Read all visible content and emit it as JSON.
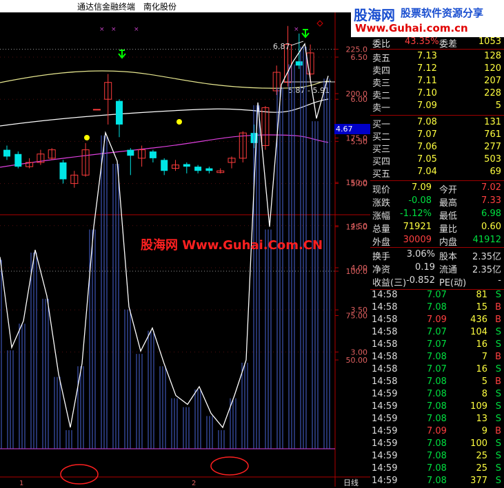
{
  "title": {
    "app": "通达信金融终端",
    "stock": "南化股份"
  },
  "logo": {
    "brand": "股海网",
    "slogan": "股票软件资源分享",
    "url": "Www.Guhai.com.cn"
  },
  "watermark": "股海网 Www.Guhai.Com.CN",
  "price_axis": [
    "6.50",
    "6.00",
    "5.50",
    "5.00",
    "4.50",
    "4.00",
    "3.50",
    "3.00"
  ],
  "current_price_tag": "4.67",
  "annotations": {
    "high_label": "6.87",
    "range_label": "5.87 - 5.91"
  },
  "indicator_axis": [
    "250.0",
    "225.0",
    "200.0",
    "175.0",
    "150.0",
    "125.0",
    "100.0",
    "75.00",
    "50.00"
  ],
  "bottom": {
    "period_label": "日线",
    "mark1": "1",
    "mark2": "2"
  },
  "quote": {
    "top": {
      "wei_bi_label": "委比",
      "wei_bi": "43.35%",
      "wei_cha_label": "委差",
      "wei_cha": "1053"
    },
    "sell": [
      {
        "label": "卖五",
        "price": "7.13",
        "vol": "128"
      },
      {
        "label": "卖四",
        "price": "7.12",
        "vol": "120"
      },
      {
        "label": "卖三",
        "price": "7.11",
        "vol": "207"
      },
      {
        "label": "卖二",
        "price": "7.10",
        "vol": "228"
      },
      {
        "label": "卖一",
        "price": "7.09",
        "vol": "5"
      }
    ],
    "buy": [
      {
        "label": "买一",
        "price": "7.08",
        "vol": "131"
      },
      {
        "label": "买二",
        "price": "7.07",
        "vol": "761"
      },
      {
        "label": "买三",
        "price": "7.06",
        "vol": "277"
      },
      {
        "label": "买四",
        "price": "7.05",
        "vol": "503"
      },
      {
        "label": "买五",
        "price": "7.04",
        "vol": "69"
      }
    ],
    "stats": [
      {
        "l1": "现价",
        "v1": "7.09",
        "l2": "今开",
        "v2": "7.02"
      },
      {
        "l1": "涨跌",
        "v1": "-0.08",
        "l2": "最高",
        "v2": "7.33"
      },
      {
        "l1": "涨幅",
        "v1": "-1.12%",
        "l2": "最低",
        "v2": "6.98"
      },
      {
        "l1": "总量",
        "v1": "71921",
        "l2": "量比",
        "v2": "0.60"
      },
      {
        "l1": "外盘",
        "v1": "30009",
        "l2": "内盘",
        "v2": "41912"
      }
    ],
    "stats2": [
      {
        "l1": "换手",
        "v1": "3.06%",
        "l2": "股本",
        "v2": "2.35亿"
      },
      {
        "l1": "净资",
        "v1": "0.19",
        "l2": "流通",
        "v2": "2.35亿"
      },
      {
        "l1": "收益(三)",
        "v1": "-0.852",
        "l2": "PE(动)",
        "v2": "-"
      }
    ]
  },
  "ticks": [
    {
      "time": "14:58",
      "price": "7.07",
      "vol": "81",
      "side": "S"
    },
    {
      "time": "14:58",
      "price": "7.08",
      "vol": "15",
      "side": "B"
    },
    {
      "time": "14:58",
      "price": "7.09",
      "vol": "436",
      "side": "B"
    },
    {
      "time": "14:58",
      "price": "7.07",
      "vol": "104",
      "side": "S"
    },
    {
      "time": "14:58",
      "price": "7.07",
      "vol": "16",
      "side": "S"
    },
    {
      "time": "14:58",
      "price": "7.08",
      "vol": "7",
      "side": "B"
    },
    {
      "time": "14:58",
      "price": "7.07",
      "vol": "16",
      "side": "S"
    },
    {
      "time": "14:58",
      "price": "7.08",
      "vol": "5",
      "side": "B"
    },
    {
      "time": "14:59",
      "price": "7.08",
      "vol": "8",
      "side": "S"
    },
    {
      "time": "14:59",
      "price": "7.08",
      "vol": "109",
      "side": "S"
    },
    {
      "time": "14:59",
      "price": "7.08",
      "vol": "13",
      "side": "S"
    },
    {
      "time": "14:59",
      "price": "7.09",
      "vol": "9",
      "side": "B"
    },
    {
      "time": "14:59",
      "price": "7.08",
      "vol": "100",
      "side": "S"
    },
    {
      "time": "14:59",
      "price": "7.08",
      "vol": "25",
      "side": "S"
    },
    {
      "time": "14:59",
      "price": "7.08",
      "vol": "25",
      "side": "S"
    },
    {
      "time": "14:59",
      "price": "7.08",
      "vol": "377",
      "side": "S"
    }
  ],
  "colors": {
    "up": "#ff3c3c",
    "down": "#00e5e5",
    "yellow": "#ffff00",
    "ma_white": "#ffffff",
    "ma_yellow": "#e8e890",
    "ma_purple": "#e040e0"
  },
  "candles": [
    {
      "o": 5.4,
      "c": 5.32,
      "h": 5.45,
      "l": 5.28
    },
    {
      "o": 5.35,
      "c": 5.2,
      "h": 5.38,
      "l": 5.18
    },
    {
      "o": 5.2,
      "c": 5.25,
      "h": 5.3,
      "l": 5.18
    },
    {
      "o": 5.25,
      "c": 5.35,
      "h": 5.4,
      "l": 5.22
    },
    {
      "o": 5.3,
      "c": 5.4,
      "h": 5.42,
      "l": 5.28
    },
    {
      "o": 5.25,
      "c": 5.05,
      "h": 5.28,
      "l": 5.0
    },
    {
      "o": 5.0,
      "c": 5.1,
      "h": 5.15,
      "l": 4.95
    },
    {
      "o": 5.1,
      "c": 5.4,
      "h": 5.48,
      "l": 5.08
    },
    {
      "o": 5.88,
      "c": 5.88,
      "h": 5.88,
      "l": 5.88
    },
    {
      "o": 6.0,
      "c": 6.2,
      "h": 6.3,
      "l": 5.7
    },
    {
      "o": 5.98,
      "c": 5.7,
      "h": 6.0,
      "l": 5.55
    },
    {
      "o": 5.4,
      "c": 5.33,
      "h": 5.42,
      "l": 5.1
    },
    {
      "o": 5.3,
      "c": 5.4,
      "h": 5.45,
      "l": 5.2
    },
    {
      "o": 5.38,
      "c": 5.3,
      "h": 5.4,
      "l": 5.25
    },
    {
      "o": 5.28,
      "c": 5.15,
      "h": 5.3,
      "l": 5.1
    },
    {
      "o": 5.18,
      "c": 5.22,
      "h": 5.28,
      "l": 5.15
    },
    {
      "o": 5.23,
      "c": 5.2,
      "h": 5.25,
      "l": 5.12
    },
    {
      "o": 5.2,
      "c": 5.15,
      "h": 5.22,
      "l": 5.12
    },
    {
      "o": 5.18,
      "c": 5.15,
      "h": 5.2,
      "l": 5.12
    },
    {
      "o": 5.13,
      "c": 5.15,
      "h": 5.18,
      "l": 5.12
    },
    {
      "o": 5.25,
      "c": 5.3,
      "h": 5.32,
      "l": 5.18
    },
    {
      "o": 5.3,
      "c": 5.6,
      "h": 5.62,
      "l": 5.25
    },
    {
      "o": 5.6,
      "c": 5.48,
      "h": 5.7,
      "l": 5.42
    },
    {
      "o": 5.45,
      "c": 5.9,
      "h": 5.92,
      "l": 5.4
    },
    {
      "o": 6.1,
      "c": 6.32,
      "h": 6.4,
      "l": 6.05
    },
    {
      "o": 6.2,
      "c": 6.65,
      "h": 6.87,
      "l": 6.15
    },
    {
      "o": 6.45,
      "c": 6.4,
      "h": 6.78,
      "l": 6.36
    },
    {
      "o": 6.3,
      "c": 6.55,
      "h": 6.65,
      "l": 6.2
    }
  ],
  "indicator": [
    108,
    57,
    72,
    112,
    86,
    42,
    12,
    48,
    125,
    178,
    162,
    80,
    55,
    68,
    48,
    30,
    25,
    35,
    20,
    12,
    30,
    50,
    195,
    125,
    205,
    218,
    228,
    186,
    210
  ]
}
